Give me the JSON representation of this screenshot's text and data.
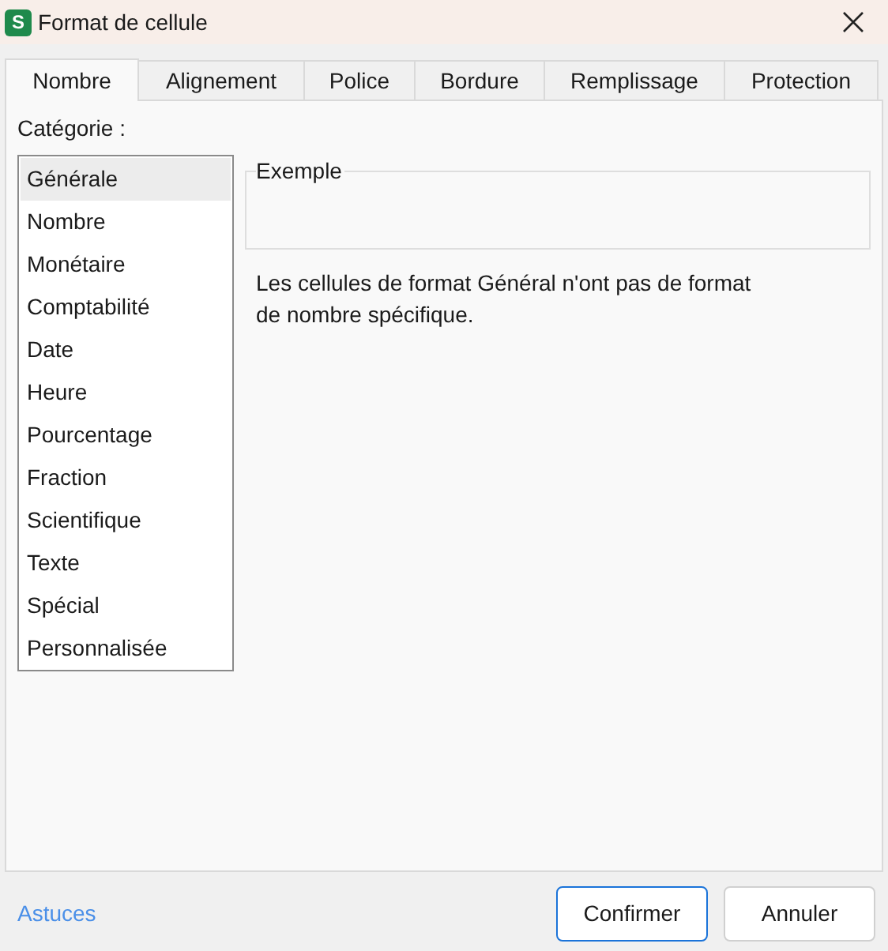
{
  "window": {
    "title": "Format de cellule",
    "app_badge": "S"
  },
  "tabs": [
    {
      "label": "Nombre",
      "selected": true
    },
    {
      "label": "Alignement",
      "selected": false
    },
    {
      "label": "Police",
      "selected": false
    },
    {
      "label": "Bordure",
      "selected": false
    },
    {
      "label": "Remplissage",
      "selected": false
    },
    {
      "label": "Protection",
      "selected": false
    }
  ],
  "category": {
    "label": "Catégorie :",
    "items": [
      {
        "label": "Générale",
        "selected": true
      },
      {
        "label": "Nombre",
        "selected": false
      },
      {
        "label": "Monétaire",
        "selected": false
      },
      {
        "label": "Comptabilité",
        "selected": false
      },
      {
        "label": "Date",
        "selected": false
      },
      {
        "label": "Heure",
        "selected": false
      },
      {
        "label": "Pourcentage",
        "selected": false
      },
      {
        "label": "Fraction",
        "selected": false
      },
      {
        "label": "Scientifique",
        "selected": false
      },
      {
        "label": "Texte",
        "selected": false
      },
      {
        "label": "Spécial",
        "selected": false
      },
      {
        "label": "Personnalisée",
        "selected": false
      }
    ]
  },
  "example": {
    "legend": "Exemple"
  },
  "description": [
    "Les cellules de format Général n'ont pas de format",
    "de nombre spécifique."
  ],
  "footer": {
    "link": "Astuces",
    "buttons": [
      "Confirmer",
      "Annuler"
    ]
  }
}
